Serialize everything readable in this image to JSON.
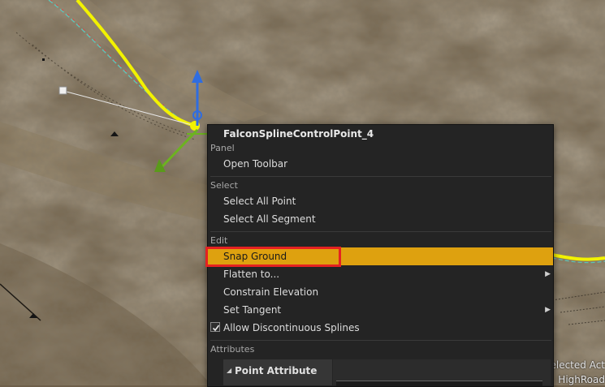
{
  "context_menu": {
    "title": "FalconSplineControlPoint_4",
    "sections": [
      {
        "header": "Panel",
        "items": [
          {
            "label": "Open Toolbar"
          }
        ]
      },
      {
        "header": "Select",
        "items": [
          {
            "label": "Select All Point"
          },
          {
            "label": "Select All Segment"
          }
        ]
      },
      {
        "header": "Edit",
        "items": [
          {
            "label": "Snap Ground",
            "highlighted": true
          },
          {
            "label": "Flatten to...",
            "submenu": true
          },
          {
            "label": "Constrain Elevation"
          },
          {
            "label": "Set Tangent",
            "submenu": true
          },
          {
            "label": "Allow Discontinuous Splines",
            "checkbox": true,
            "checked": true
          }
        ]
      },
      {
        "header": "Attributes",
        "items": []
      }
    ],
    "attribute_panel": {
      "label": "Point Attribute",
      "expanded": true
    }
  },
  "background_text": {
    "line1": "Selected Act",
    "line2": "HighRoad"
  },
  "colors": {
    "highlight": "#dea10f",
    "annotation": "#e52121",
    "spline": "#f2f200",
    "gizmo_z": "#2f6de0",
    "gizmo_y": "#6cb320"
  }
}
